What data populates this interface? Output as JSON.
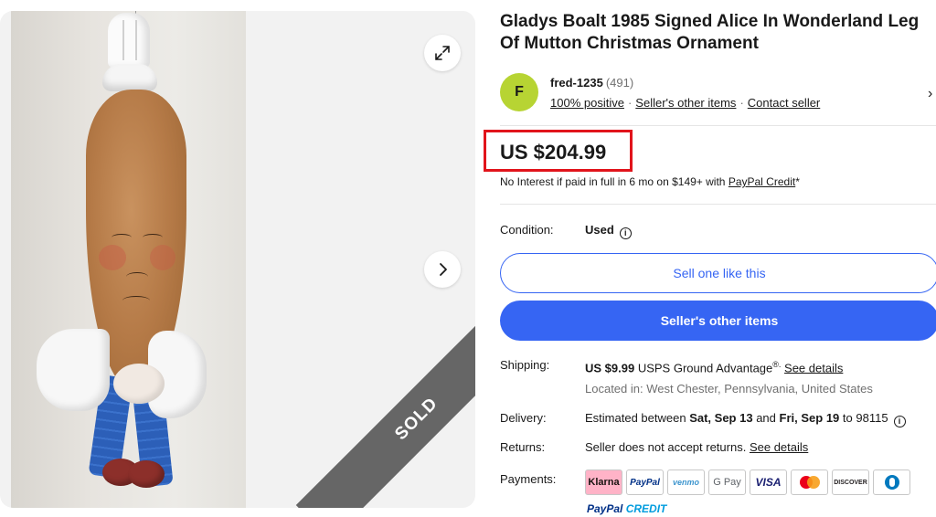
{
  "gallery": {
    "sold_label": "SOLD",
    "expand_icon": "expand-arrows-icon",
    "next_icon": "chevron-right-icon"
  },
  "listing": {
    "title": "Gladys Boalt 1985 Signed Alice In Wonderland Leg Of Mutton Christmas Ornament"
  },
  "seller": {
    "avatar_letter": "F",
    "name": "fred-1235",
    "feedback_count": "(491)",
    "positive": "100% positive",
    "other_items_link": "Seller's other items",
    "contact_link": "Contact seller",
    "avatar_color": "#b7d433"
  },
  "price": {
    "amount": "US $204.99",
    "credit_text": "No Interest if paid in full in 6 mo on $149+ with",
    "credit_link": "PayPal Credit",
    "credit_suffix": "*"
  },
  "condition": {
    "label": "Condition:",
    "value": "Used"
  },
  "buttons": {
    "sell_like_this": "Sell one like this",
    "sellers_other_items": "Seller's other items"
  },
  "shipping": {
    "label": "Shipping:",
    "cost": "US $9.99",
    "service": "USPS Ground Advantage",
    "registered": "®.",
    "details_link": "See details",
    "location": "Located in: West Chester, Pennsylvania, United States"
  },
  "delivery": {
    "label": "Delivery:",
    "prefix": "Estimated between",
    "start": "Sat, Sep 13",
    "and": "and",
    "end": "Fri, Sep 19",
    "to": "to 98115"
  },
  "returns": {
    "label": "Returns:",
    "text": "Seller does not accept returns.",
    "details_link": "See details"
  },
  "payments": {
    "label": "Payments:",
    "methods": [
      "Klarna",
      "PayPal",
      "venmo",
      "G Pay",
      "VISA",
      "Mastercard",
      "DISCOVER",
      "Diners Club"
    ],
    "paypal_credit": "PayPal",
    "paypal_credit_word": "CREDIT"
  },
  "colors": {
    "accent_blue": "#3665f3",
    "highlight_red": "#e1141b",
    "sold_ribbon": "#666666"
  }
}
